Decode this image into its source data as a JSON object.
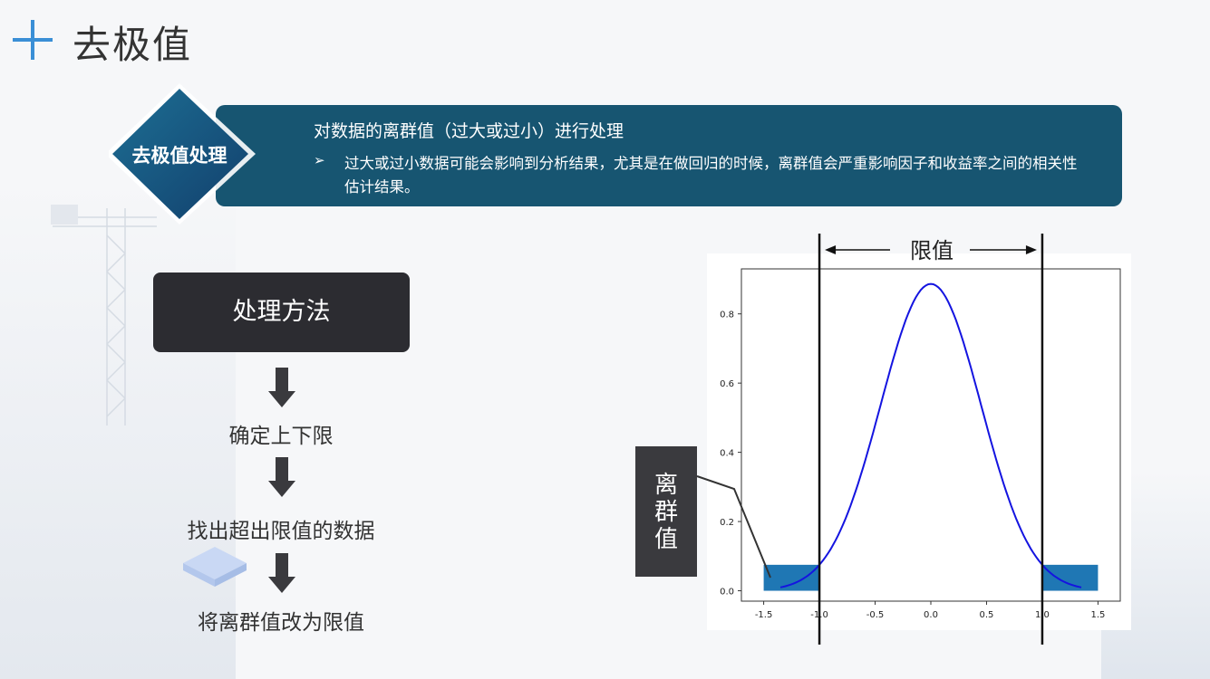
{
  "title": "去极值",
  "banner": {
    "tag": "去极值处理",
    "heading": "对数据的离群值（过大或过小）进行处理",
    "bullet_icon": "➢",
    "bullet_text": "过大或过小数据可能会影响到分析结果，尤其是在做回归的时候，离群值会严重影响因子和收益率之间的相关性估计结果。",
    "color": "#175571"
  },
  "method": {
    "title": "处理方法",
    "steps": [
      "确定上下限",
      "找出超出限值的数据",
      "将离群值改为限值"
    ]
  },
  "callout": {
    "chars": [
      "离",
      "群",
      "值"
    ]
  },
  "chart_data": {
    "type": "line",
    "curve": {
      "function": "normal pdf",
      "mean": 0,
      "std": 0.45,
      "x_range": [
        -1.35,
        1.35
      ],
      "color": "#1414e0"
    },
    "xlim": [
      -1.7,
      1.7
    ],
    "ylim": [
      -0.03,
      0.93
    ],
    "xticks": [
      "-1.5",
      "-1.0",
      "-0.5",
      "0.0",
      "0.5",
      "1.0",
      "1.5"
    ],
    "yticks": [
      "0.0",
      "0.2",
      "0.4",
      "0.6",
      "0.8"
    ],
    "limits": [
      -1.0,
      1.0
    ],
    "limit_label": "限值",
    "outlier_regions": [
      {
        "x": [
          -1.5,
          -1.0
        ],
        "height": 0.075
      },
      {
        "x": [
          1.0,
          1.5
        ],
        "height": 0.075
      }
    ],
    "region_color": "#1f77b4"
  }
}
